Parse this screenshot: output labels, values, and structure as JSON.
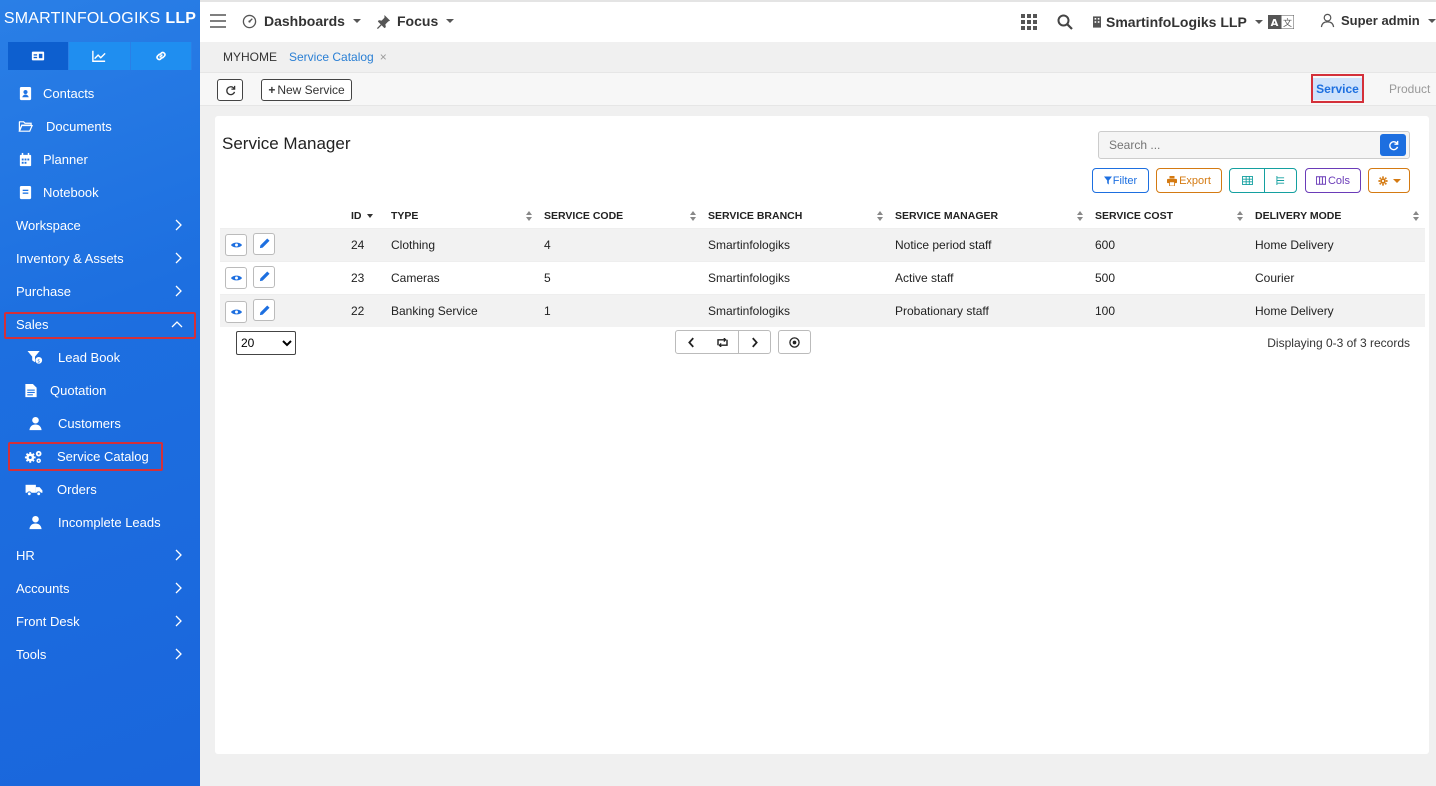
{
  "brand": {
    "name": "SMARTINFOLOGIKS",
    "suffix": "LLP"
  },
  "sidebar": {
    "top_items": [
      {
        "label": "Contacts",
        "icon": "contact-card-icon"
      },
      {
        "label": "Documents",
        "icon": "folder-open-icon"
      },
      {
        "label": "Planner",
        "icon": "calendar-icon"
      },
      {
        "label": "Notebook",
        "icon": "notebook-icon"
      }
    ],
    "sections": {
      "workspace": "Workspace",
      "inventory": "Inventory & Assets",
      "purchase": "Purchase",
      "sales": "Sales",
      "hr": "HR",
      "accounts": "Accounts",
      "front_desk": "Front Desk",
      "tools": "Tools"
    },
    "sales_items": {
      "lead_book": "Lead Book",
      "quotation": "Quotation",
      "customers": "Customers",
      "service_catalog": "Service Catalog",
      "orders": "Orders",
      "incomplete_leads": "Incomplete Leads"
    }
  },
  "topbar": {
    "dashboards": "Dashboards",
    "focus": "Focus",
    "company": "SmartinfoLogiks LLP",
    "user": "Super admin"
  },
  "breadcrumb": {
    "home": "MYHOME",
    "tab": "Service Catalog",
    "close": "×"
  },
  "toolbar": {
    "new_service": "New Service",
    "seg_service": "Service",
    "seg_product": "Product"
  },
  "main": {
    "title": "Service Manager",
    "search_placeholder": "Search ...",
    "filter": "Filter",
    "export": "Export",
    "cols": "Cols",
    "table": {
      "headers": [
        "ID",
        "TYPE",
        "SERVICE CODE",
        "SERVICE BRANCH",
        "SERVICE MANAGER",
        "SERVICE COST",
        "DELIVERY MODE"
      ],
      "rows": [
        [
          "24",
          "Clothing",
          "4",
          "Smartinfologiks",
          "Notice period staff",
          "600",
          "Home Delivery"
        ],
        [
          "23",
          "Cameras",
          "5",
          "Smartinfologiks",
          "Active staff",
          "500",
          "Courier"
        ],
        [
          "22",
          "Banking Service",
          "1",
          "Smartinfologiks",
          "Probationary staff",
          "100",
          "Home Delivery"
        ]
      ]
    },
    "page_size": "20",
    "records": "Displaying 0-3 of 3 records"
  },
  "colors": {
    "accent": "#1d6fe0",
    "highlight": "#d4303a",
    "export": "#d47a12",
    "cols": "#6a3bb8"
  }
}
